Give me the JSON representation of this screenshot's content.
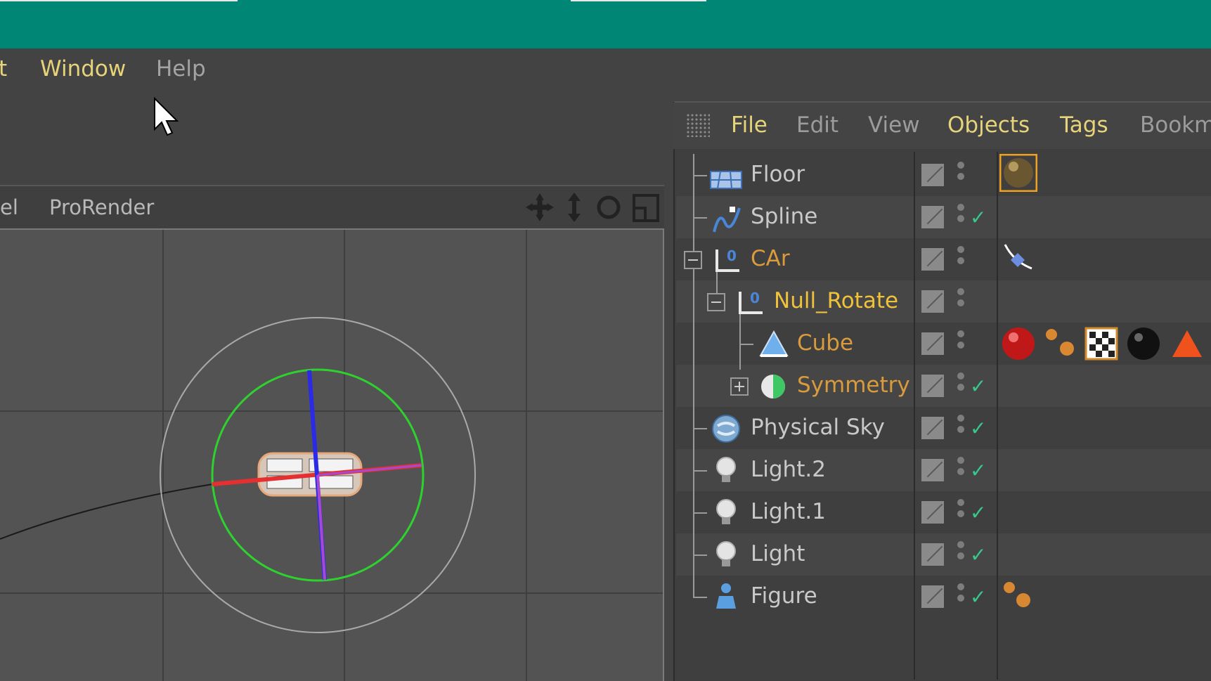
{
  "menubar": {
    "items": [
      "t",
      "Window",
      "Help"
    ]
  },
  "viewport": {
    "tabs": [
      "el",
      "ProRender"
    ],
    "nav_icons": [
      "move-icon",
      "dolly-icon",
      "rotate-icon",
      "maximize-icon"
    ]
  },
  "object_manager": {
    "menu": [
      "File",
      "Edit",
      "View",
      "Objects",
      "Tags",
      "Bookm"
    ],
    "objects": [
      {
        "name": "Floor",
        "icon": "floor-icon",
        "checked": false,
        "tags": [
          "brown-material-tag"
        ]
      },
      {
        "name": "Spline",
        "icon": "spline-icon",
        "checked": true,
        "tags": []
      },
      {
        "name": "CAr",
        "icon": "null-icon",
        "checked": false,
        "tags": [
          "align-to-spline-tag"
        ]
      },
      {
        "name": "Null_Rotate",
        "icon": "null-icon",
        "checked": false,
        "tags": []
      },
      {
        "name": "Cube",
        "icon": "cube-icon",
        "checked": false,
        "tags": [
          "red-material-tag",
          "phong-tag",
          "checker-material-tag",
          "black-material-tag",
          "triangle-warning-tag"
        ]
      },
      {
        "name": "Symmetry",
        "icon": "symmetry-icon",
        "checked": true,
        "tags": []
      },
      {
        "name": "Physical Sky",
        "icon": "sky-icon",
        "checked": true,
        "tags": []
      },
      {
        "name": "Light.2",
        "icon": "light-icon",
        "checked": true,
        "tags": []
      },
      {
        "name": "Light.1",
        "icon": "light-icon",
        "checked": true,
        "tags": []
      },
      {
        "name": "Light",
        "icon": "light-icon",
        "checked": true,
        "tags": []
      },
      {
        "name": "Figure",
        "icon": "figure-icon",
        "checked": true,
        "tags": [
          "phong-tag"
        ]
      }
    ]
  },
  "colors": {
    "titlebar": "#008674",
    "menu_active": "#e6d37a",
    "object_orange": "#d99b3c",
    "object_yellow": "#f0c23a",
    "check": "#37c88d"
  }
}
